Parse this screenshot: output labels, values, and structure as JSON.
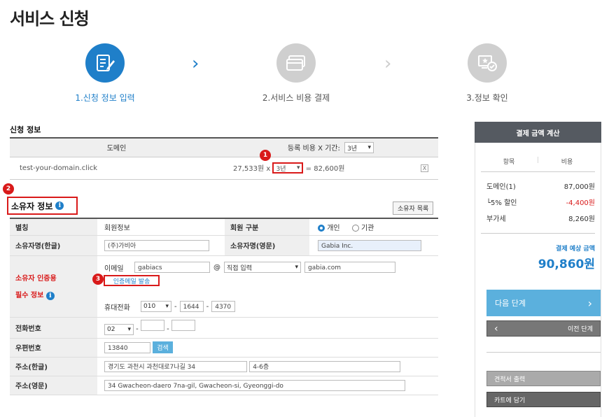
{
  "page": {
    "title": "서비스 신청"
  },
  "steps": [
    {
      "label": "1.신청 정보 입력",
      "active": true,
      "icon": "form-edit-icon"
    },
    {
      "label": "2.서비스 비용 결제",
      "active": false,
      "icon": "card-payment-icon"
    },
    {
      "label": "3.정보 확인",
      "active": false,
      "icon": "certificate-check-icon"
    }
  ],
  "application": {
    "title": "신청 정보",
    "col_domain": "도메인",
    "col_period": "등록 비용 X 기간:",
    "period_select": "3년",
    "domain": "test-your-domain.click",
    "unit_price": "27,533원 x",
    "row_period": "3년",
    "total": "= 82,600원",
    "remove": "X"
  },
  "owner": {
    "title": "소유자 정보",
    "list_button": "소유자 목록",
    "alias_label": "별칭",
    "alias_value": "회원정보",
    "member_type_label": "회원 구분",
    "member_type_options": [
      "개인",
      "기관"
    ],
    "member_type_selected": "개인",
    "name_kr_label": "소유자명(한글)",
    "name_kr_value": "(주)가비아",
    "name_en_label": "소유자명(영문)",
    "name_en_value": "Gabia Inc.",
    "auth_label_red": "소유자 인증용",
    "auth_label_black": "필수 정보",
    "email_label": "이메일",
    "email_id": "gabiacs",
    "email_at": "@",
    "email_domain_select": "직접 입력",
    "email_domain": "gabia.com",
    "auth_mail_button": "인증메일 발송",
    "mobile_label": "휴대전화",
    "mobile_1": "010",
    "mobile_2": "1644",
    "mobile_3": "4370",
    "phone_label": "전화번호",
    "phone_1": "02",
    "phone_2": "",
    "phone_3": "",
    "zip_label": "우편번호",
    "zip_value": "13840",
    "zip_search": "검색",
    "addr_kr_label": "주소(한글)",
    "addr_kr_1": "경기도 과천시 과천대로7나길 34",
    "addr_kr_2": "4-6층",
    "addr_en_label": "주소(영문)",
    "addr_en": "34 Gwacheon-daero 7na-gil, Gwacheon-si, Gyeonggi-do"
  },
  "badges": {
    "b1": "1",
    "b2": "2",
    "b3": "3"
  },
  "sidebar": {
    "header": "결제 금액 계산",
    "col_item": "항목",
    "col_cost": "비용",
    "rows": [
      {
        "label": "도메인(1)",
        "value": "87,000원",
        "red": false
      },
      {
        "label": "└5% 할인",
        "value": "-4,400원",
        "red": true
      },
      {
        "label": "부가세",
        "value": "8,260원",
        "red": false
      }
    ],
    "expected_label": "결제 예상 금액",
    "expected_value": "90,860원",
    "next_button": "다음 단계",
    "prev_button": "이전 단계",
    "quote_button": "견적서 출력",
    "cart_button": "카트에 담기"
  },
  "colors": {
    "accent": "#1f7fc9",
    "badge_red": "#d91a1a",
    "sidebar_header": "#555a61"
  }
}
